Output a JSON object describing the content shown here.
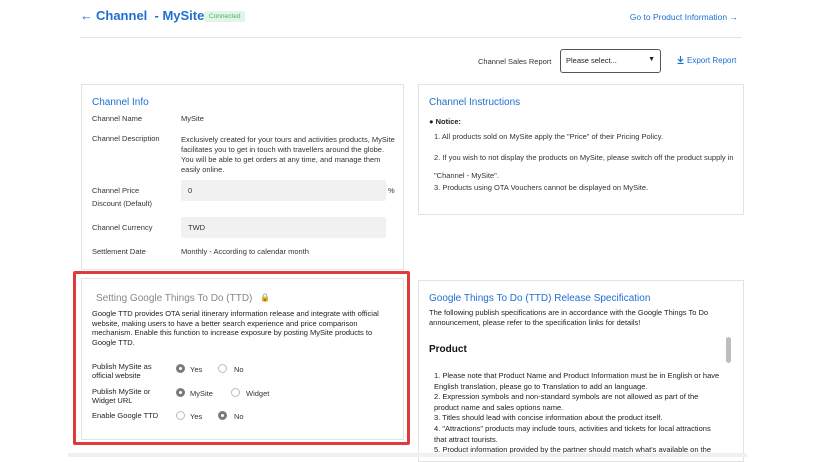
{
  "header": {
    "back_icon": "←",
    "title": "Channel  - MySite",
    "badge": "Connected",
    "goto_link": "Go to Product Information →"
  },
  "toolbar": {
    "sales_label": "Channel Sales Report",
    "select_value": "Please select...",
    "export_label": "Export Report"
  },
  "channel_info": {
    "title": "Channel Info",
    "name_label": "Channel Name",
    "name_value": "MySite",
    "desc_label": "Channel Description",
    "desc_value": "Exclusively created for your tours and activities products, MySite facilitates you to get in touch with travellers around the globe. You will be able to get orders at any time, and manage them easily online.",
    "discount_label_1": "Channel Price",
    "discount_label_2": "Discount (Default)",
    "discount_value": "0",
    "discount_unit": "%",
    "currency_label": "Channel Currency",
    "currency_value": "TWD",
    "settlement_label": "Settlement Date",
    "settlement_value": "Monthly - According to calendar month"
  },
  "instructions": {
    "title": "Channel Instructions",
    "notice": "● Notice:",
    "items": [
      "1. All products sold on MySite apply the \"Price\" of their Pricing Policy.",
      "2. If you wish to not display the products on MySite, please switch off the product supply in \"Channel - MySite\".",
      "3. Products using OTA Vouchers cannot be displayed on MySite."
    ]
  },
  "ttd": {
    "title": "Setting Google Things To Do (TTD)",
    "lock_icon": "🔒",
    "description": "Google TTD provides OTA serial itinerary information release and integrate with official website, making users to have a better search experience and price comparison mechanism. Enable this function to increase exposure by posting MySite products to Google TTD.",
    "options": [
      {
        "label_1": "Publish MySite as",
        "label_2": "official website",
        "a": "Yes",
        "b": "No",
        "selected": "a"
      },
      {
        "label_1": "Publish MySite or",
        "label_2": "Widget URL",
        "a": "MySite",
        "b": "Widget",
        "selected": "a"
      },
      {
        "label_1": "Enable Google TTD",
        "label_2": "",
        "a": "Yes",
        "b": "No",
        "selected": "b"
      }
    ]
  },
  "spec": {
    "title": "Google Things To Do (TTD) Release Specification",
    "description": "The following publish specifications are in accordance with the Google Things To Do announcement, please refer to the specification links for details!",
    "product_heading": "Product",
    "items": [
      "1. Please note that Product Name and Product Information must be in English or have English translation, please go to Translation to add an language.",
      "2. Expression symbols and non-standard symbols are not allowed as part of the product name and sales options name.",
      "3. Titles should lead with concise information about the product itself.",
      "4. \"Attractions\" products may include tours, activities and tickets for local attractions that attract tourists.",
      "5. Product information provided by the partner should match what's available on the"
    ]
  },
  "colors": {
    "accent": "#1f6fd1",
    "highlight": "#e03b3b",
    "badge_bg": "#e2f5e6",
    "badge_text": "#4caf6a"
  }
}
